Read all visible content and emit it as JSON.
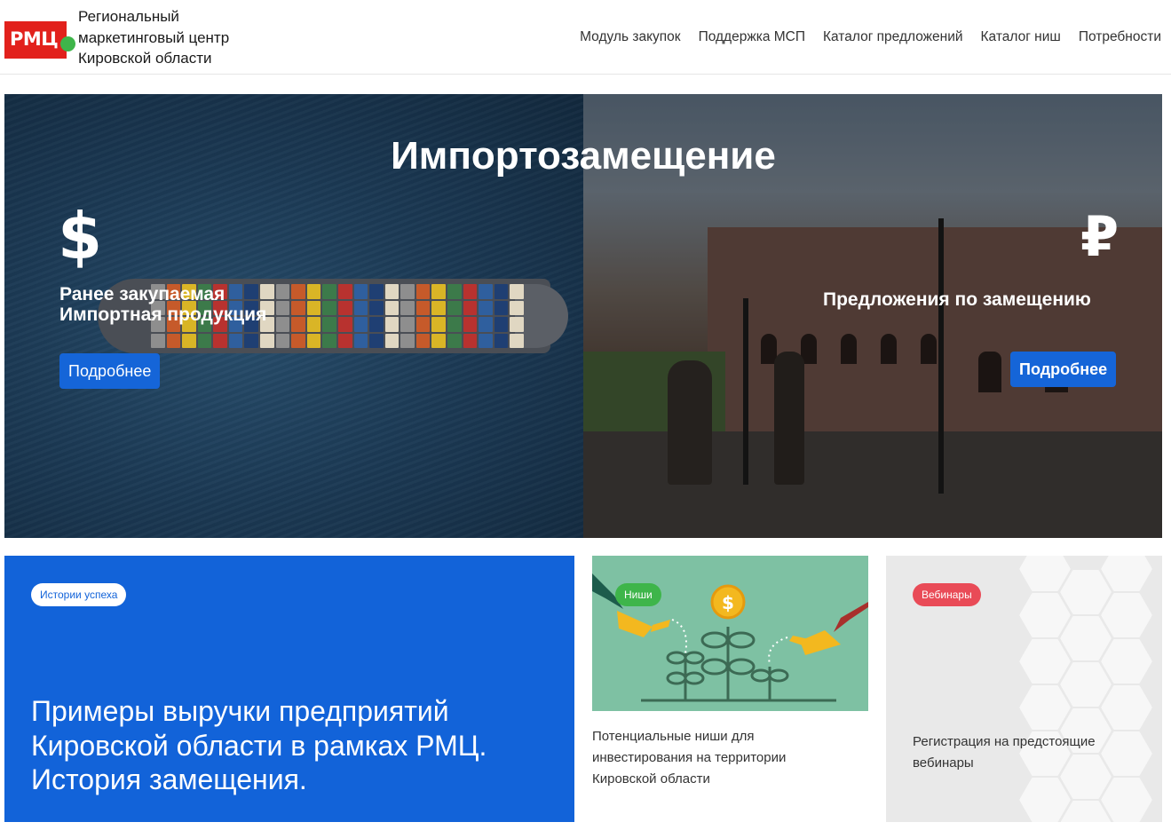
{
  "header": {
    "logo_text": "РМЦ",
    "org_name_lines": [
      "Региональный",
      "маркетинговый центр",
      "Кировской области"
    ],
    "nav": [
      "Модуль закупок",
      "Поддержка МСП",
      "Каталог предложений",
      "Каталог ниш",
      "Потребности"
    ]
  },
  "hero": {
    "title": "Импортозамещение",
    "left": {
      "icon": "$",
      "text_lines": [
        "Ранее закупаемая",
        "Импортная продукция"
      ],
      "button": "Подробнее"
    },
    "right": {
      "icon": "₽",
      "text": "Предложения по замещению",
      "button": "Подробнее"
    }
  },
  "cards": {
    "success": {
      "tag": "Истории успеха",
      "title_lines": [
        "Примеры выручки предприятий",
        "Кировской области в рамках РМЦ.",
        "История замещения."
      ]
    },
    "niches": {
      "tag": "Ниши",
      "text_lines": [
        "Потенциальные ниши для",
        "инвестирования на территории",
        "Кировской области"
      ]
    },
    "webinars": {
      "tag": "Вебинары",
      "text_lines": [
        "Регистрация на предстоящие",
        "вебинары"
      ]
    }
  },
  "colors": {
    "brand_red": "#e2211c",
    "brand_green": "#3eb54a",
    "primary_blue": "#1263d9",
    "button_blue": "#1565d8",
    "webinar_red": "#e94b57",
    "niche_green": "#7ec1a3"
  }
}
